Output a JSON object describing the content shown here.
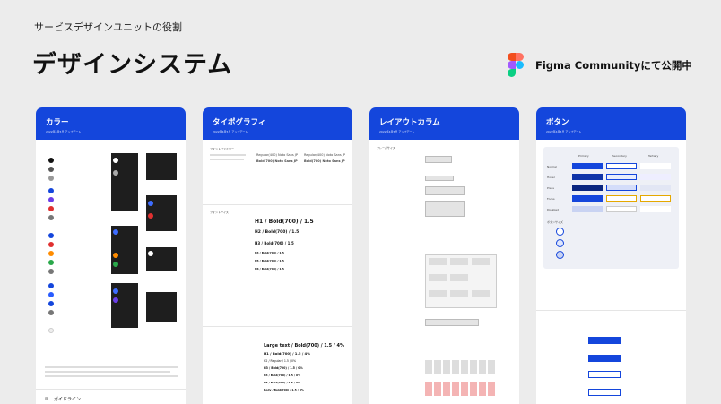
{
  "header": {
    "subtitle": "サービスデザインユニットの役割",
    "title": "デザインシステム",
    "figma_label": "Figma Communityにて公開中"
  },
  "cards": {
    "color": {
      "title": "カラー",
      "date": "2022年4月5日 アップデート",
      "guideline": "ガイドライン"
    },
    "typo": {
      "title": "タイポグラフィ",
      "date": "2022年4月5日 アップデート",
      "font_family": "フォントファミリー",
      "regular": "Regular(400) Noto Sans JP",
      "bold": "Bold(700) Noto Sans JP",
      "font_size": "フォントサイズ",
      "samples": [
        "H1 / Bold(700) / 1.5",
        "H2 / Bold(700) / 1.5",
        "H3 / Bold(700) / 1.5",
        "H4 / Bold(700) / 1.5",
        "H5 / Bold(700) / 1.5",
        "H6 / Bold(700) / 1.5"
      ],
      "large": "Large text / Bold(700) / 1.5 / 4%",
      "list": [
        "H1 / Bold(700) / 1.5 / 4%",
        "H2 / Regular / 1.5 / 0%",
        "H3 / Bold(700) / 1.5 / 0%",
        "H4 / Bold(700) / 1.5 / 0%",
        "H5 / Bold(700) / 1.5 / 0%",
        "Body / Bold(700) / 1.5 / 0%"
      ]
    },
    "layout": {
      "title": "レイアウトカラム",
      "date": "2022年4月5日 アップデート",
      "frame": "フレームサイズ"
    },
    "button": {
      "title": "ボタン",
      "date": "2022年4月5日 アップデート",
      "label": "ボタン",
      "cols": [
        "Primary",
        "Secondary",
        "Tertiary"
      ],
      "rows": [
        "Normal",
        "Hover",
        "Press",
        "Focus",
        "Disabled"
      ],
      "states": [
        "Normal",
        "Hover",
        "Press",
        "Focus",
        "Disabled"
      ],
      "section": "ボタンサイズ"
    }
  },
  "colors": {
    "blue": "#1446dc",
    "figma_red": "#f24e1e",
    "figma_orange": "#ff7262",
    "figma_purple": "#a259ff",
    "figma_blue": "#1abcfe",
    "figma_green": "#0acf83"
  }
}
